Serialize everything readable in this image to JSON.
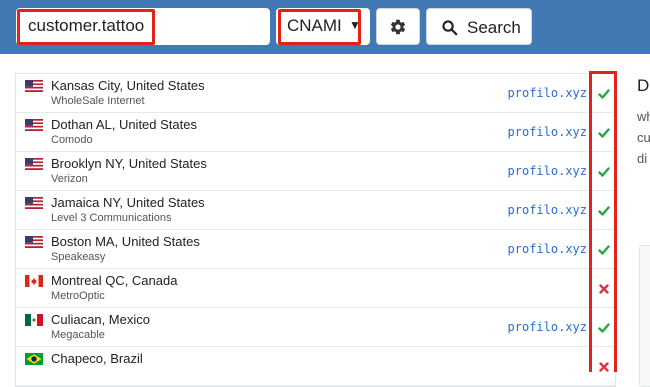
{
  "search": {
    "query": "customer.tattoo"
  },
  "record_type": {
    "selected": "CNAMI"
  },
  "toolbar": {
    "search_label": "Search"
  },
  "results": [
    {
      "flag": "us",
      "city": "Kansas City, United States",
      "isp": "WholeSale Internet",
      "value": "profilo.xyz",
      "status": "ok"
    },
    {
      "flag": "us",
      "city": "Dothan AL, United States",
      "isp": "Comodo",
      "value": "profilo.xyz",
      "status": "ok"
    },
    {
      "flag": "us",
      "city": "Brooklyn NY, United States",
      "isp": "Verizon",
      "value": "profilo.xyz",
      "status": "ok"
    },
    {
      "flag": "us",
      "city": "Jamaica NY, United States",
      "isp": "Level 3 Communications",
      "value": "profilo.xyz",
      "status": "ok"
    },
    {
      "flag": "us",
      "city": "Boston MA, United States",
      "isp": "Speakeasy",
      "value": "profilo.xyz",
      "status": "ok"
    },
    {
      "flag": "ca",
      "city": "Montreal QC, Canada",
      "isp": "MetroOptic",
      "value": "",
      "status": "fail"
    },
    {
      "flag": "mx",
      "city": "Culiacan, Mexico",
      "isp": "Megacable",
      "value": "profilo.xyz",
      "status": "ok"
    },
    {
      "flag": "br",
      "city": "Chapeco, Brazil",
      "isp": "",
      "value": "",
      "status": "fail"
    }
  ],
  "side": {
    "title": "D",
    "text": "wh\ncu\ndi"
  },
  "colors": {
    "header": "#4278b4",
    "highlight": "#e0241c",
    "ok": "#28a745",
    "fail": "#dc3545",
    "value": "#2a6ccf"
  },
  "icons": {
    "settings": "gear-icon",
    "search": "magnifier-icon",
    "ok": "check-icon",
    "fail": "cross-icon"
  }
}
